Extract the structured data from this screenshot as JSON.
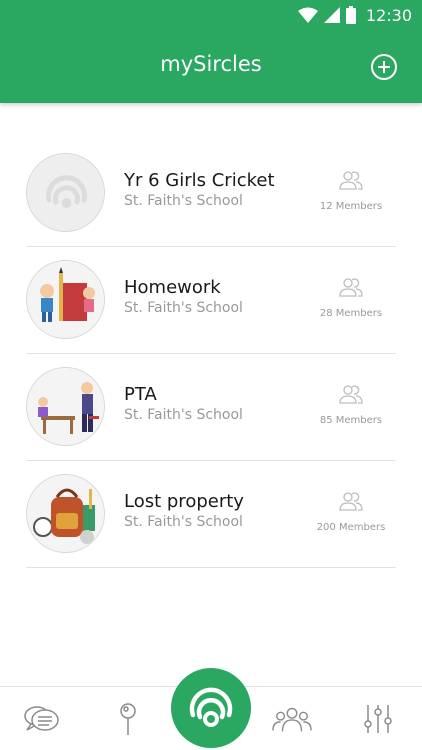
{
  "status_bar": {
    "time": "12:30"
  },
  "header": {
    "title": "mySircles"
  },
  "circles": [
    {
      "title": "Yr 6 Girls Cricket",
      "school": "St. Faith's School",
      "members": "12 Members",
      "avatar_icon": "sircles-logo-placeholder"
    },
    {
      "title": "Homework",
      "school": "St. Faith's School",
      "members": "28 Members",
      "avatar_icon": "kids-with-book-illustration"
    },
    {
      "title": "PTA",
      "school": "St. Faith's School",
      "members": "85 Members",
      "avatar_icon": "parent-teacher-illustration"
    },
    {
      "title": "Lost property",
      "school": "St. Faith's School",
      "members": "200 Members",
      "avatar_icon": "school-bag-illustration"
    }
  ],
  "bottom_nav": {
    "items": [
      "chat-icon",
      "location-pin-icon",
      "sircles-icon",
      "people-icon",
      "settings-sliders-icon"
    ],
    "active": "sircles-icon"
  },
  "colors": {
    "brand": "#2aa761",
    "text": "#1a1a1a",
    "muted": "#999999"
  }
}
